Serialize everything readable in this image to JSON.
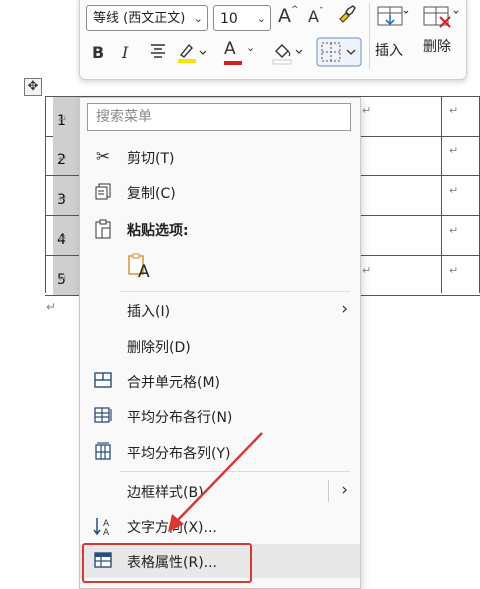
{
  "mini_toolbar": {
    "font_name": "等线 (西文正文)",
    "font_size": "10",
    "grow_font": "A",
    "shrink_font": "A",
    "bold": "B",
    "italic": "I",
    "font_color": "A",
    "insert_label": "插入",
    "delete_label": "删除"
  },
  "table": {
    "rows": [
      "1",
      "2",
      "3",
      "4",
      "5"
    ],
    "cell_mark": "↵"
  },
  "context_menu": {
    "search_placeholder": "搜索菜单",
    "cut": "剪切(T)",
    "copy": "复制(C)",
    "paste_options": "粘贴选项:",
    "paste_keep_text": "A",
    "insert": "插入(I)",
    "delete_col": "删除列(D)",
    "merge_cells": "合并单元格(M)",
    "distribute_rows": "平均分布各行(N)",
    "distribute_cols": "平均分布各列(Y)",
    "border_styles": "边框样式(B)",
    "text_direction": "文字方向(X)...",
    "table_properties": "表格属性(R)..."
  },
  "colors": {
    "accent_red": "#d43a33",
    "highlight_yellow": "#f5e400",
    "font_red": "#d21f1f",
    "icon_blue": "#2a4d7a"
  }
}
